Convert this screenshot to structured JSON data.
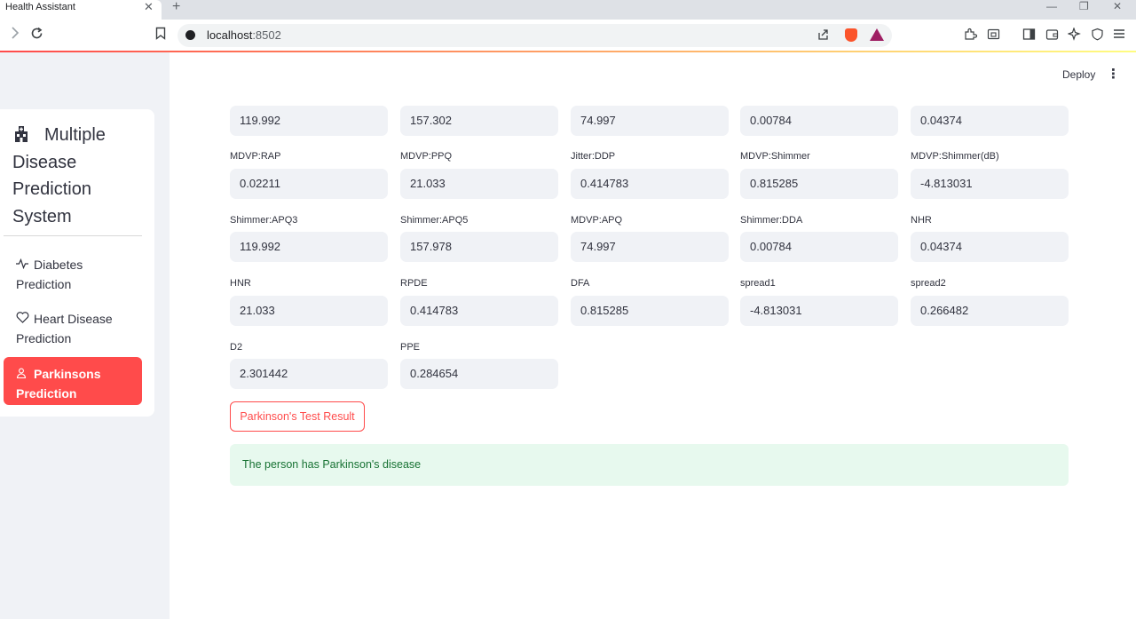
{
  "browser": {
    "tab_title": "Health Assistant",
    "tab_close": "✕",
    "new_tab": "+",
    "url_host": "localhost",
    "url_port": ":8502"
  },
  "header": {
    "deploy_label": "Deploy"
  },
  "sidebar": {
    "title": "Multiple Disease Prediction System",
    "items": [
      {
        "label": "Diabetes Prediction",
        "icon": "activity-icon",
        "active": false
      },
      {
        "label": "Heart Disease Prediction",
        "icon": "heart-icon",
        "active": false
      },
      {
        "label": "Parkinsons Prediction",
        "icon": "person-icon",
        "active": true
      }
    ]
  },
  "form": {
    "row1": {
      "values": [
        "119.992",
        "157.302",
        "74.997",
        "0.00784",
        "0.04374"
      ]
    },
    "row2": {
      "labels": [
        "MDVP:RAP",
        "MDVP:PPQ",
        "Jitter:DDP",
        "MDVP:Shimmer",
        "MDVP:Shimmer(dB)"
      ],
      "values": [
        "0.02211",
        "21.033",
        "0.414783",
        "0.815285",
        "-4.813031"
      ]
    },
    "row3": {
      "labels": [
        "Shimmer:APQ3",
        "Shimmer:APQ5",
        "MDVP:APQ",
        "Shimmer:DDA",
        "NHR"
      ],
      "values": [
        "119.992",
        "157.978",
        "74.997",
        "0.00784",
        "0.04374"
      ]
    },
    "row4": {
      "labels": [
        "HNR",
        "RPDE",
        "DFA",
        "spread1",
        "spread2"
      ],
      "values": [
        "21.033",
        "0.414783",
        "0.815285",
        "-4.813031",
        "0.266482"
      ]
    },
    "row5": {
      "labels": [
        "D2",
        "PPE"
      ],
      "values": [
        "2.301442",
        "0.284654"
      ]
    }
  },
  "actions": {
    "result_button": "Parkinson's Test Result"
  },
  "result": {
    "message": "The person has Parkinson's disease"
  },
  "colors": {
    "accent": "#ff4b4b",
    "success_bg": "#e7f9ee",
    "success_text": "#177233",
    "input_bg": "#f0f2f6"
  }
}
